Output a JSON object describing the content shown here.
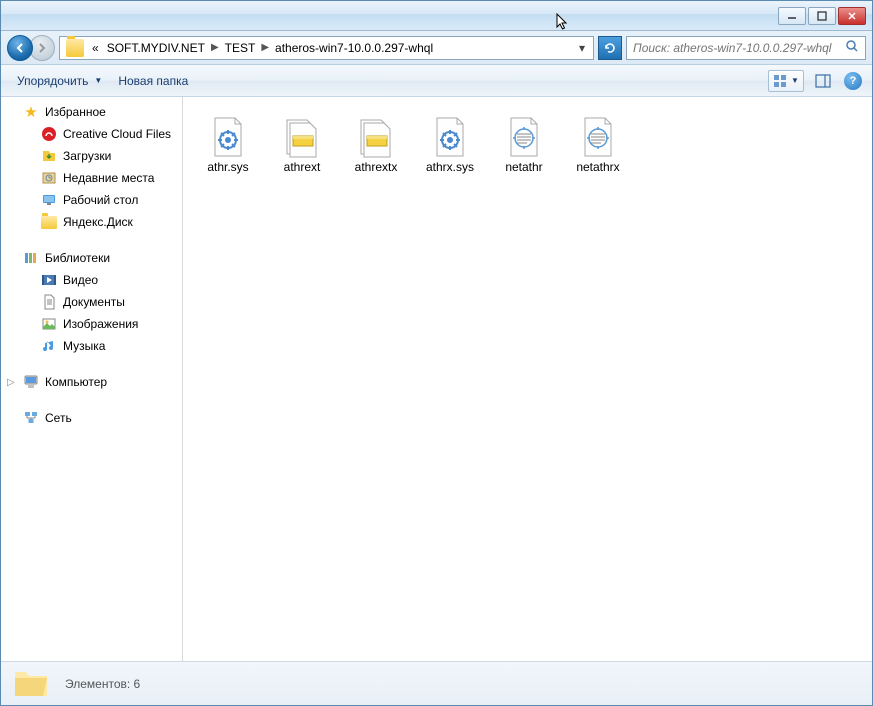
{
  "breadcrumbs": {
    "prefix": "«",
    "items": [
      "SOFT.MYDIV.NET",
      "TEST",
      "atheros-win7-10.0.0.297-whql"
    ]
  },
  "search": {
    "placeholder": "Поиск: atheros-win7-10.0.0.297-whql"
  },
  "toolbar": {
    "organize": "Упорядочить",
    "new_folder": "Новая папка"
  },
  "sidebar": {
    "favorites": {
      "label": "Избранное",
      "items": [
        {
          "icon": "creative-cloud",
          "label": "Creative Cloud Files"
        },
        {
          "icon": "downloads",
          "label": "Загрузки"
        },
        {
          "icon": "recent",
          "label": "Недавние места"
        },
        {
          "icon": "desktop",
          "label": "Рабочий стол"
        },
        {
          "icon": "yandex-disk",
          "label": "Яндекс.Диск"
        }
      ]
    },
    "libraries": {
      "label": "Библиотеки",
      "items": [
        {
          "icon": "videos",
          "label": "Видео"
        },
        {
          "icon": "documents",
          "label": "Документы"
        },
        {
          "icon": "pictures",
          "label": "Изображения"
        },
        {
          "icon": "music",
          "label": "Музыка"
        }
      ]
    },
    "computer": {
      "label": "Компьютер"
    },
    "network": {
      "label": "Сеть"
    }
  },
  "files": [
    {
      "name": "athr.sys",
      "type": "sys"
    },
    {
      "name": "athrext",
      "type": "cat"
    },
    {
      "name": "athrextx",
      "type": "cat"
    },
    {
      "name": "athrx.sys",
      "type": "sys"
    },
    {
      "name": "netathr",
      "type": "inf"
    },
    {
      "name": "netathrx",
      "type": "inf"
    }
  ],
  "status": {
    "text": "Элементов: 6"
  }
}
